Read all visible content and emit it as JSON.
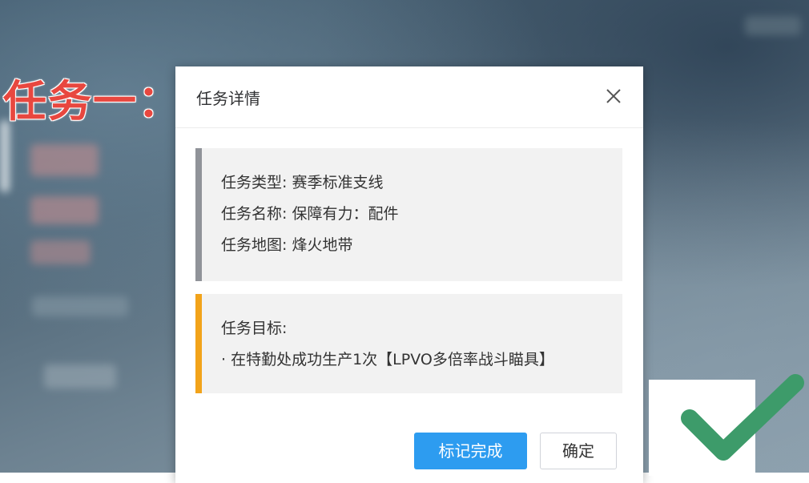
{
  "overlay": {
    "task_label": "任务一："
  },
  "dialog": {
    "title": "任务详情",
    "info": [
      "任务类型: 赛季标准支线",
      "任务名称: 保障有力：配件",
      "任务地图: 烽火地带"
    ],
    "goal": [
      "任务目标:",
      "· 在特勤处成功生产1次【LPVO多倍率战斗瞄具】"
    ],
    "buttons": {
      "mark_complete": "标记完成",
      "confirm": "确定"
    }
  },
  "colors": {
    "overlay_label": "#e8473f",
    "primary_button": "#2d9cf0",
    "info_bar": "#909399",
    "goal_bar": "#f2a31a",
    "checkmark": "#3d9b6a"
  },
  "icons": {
    "close": "close-icon",
    "checkmark": "checkmark-icon"
  }
}
